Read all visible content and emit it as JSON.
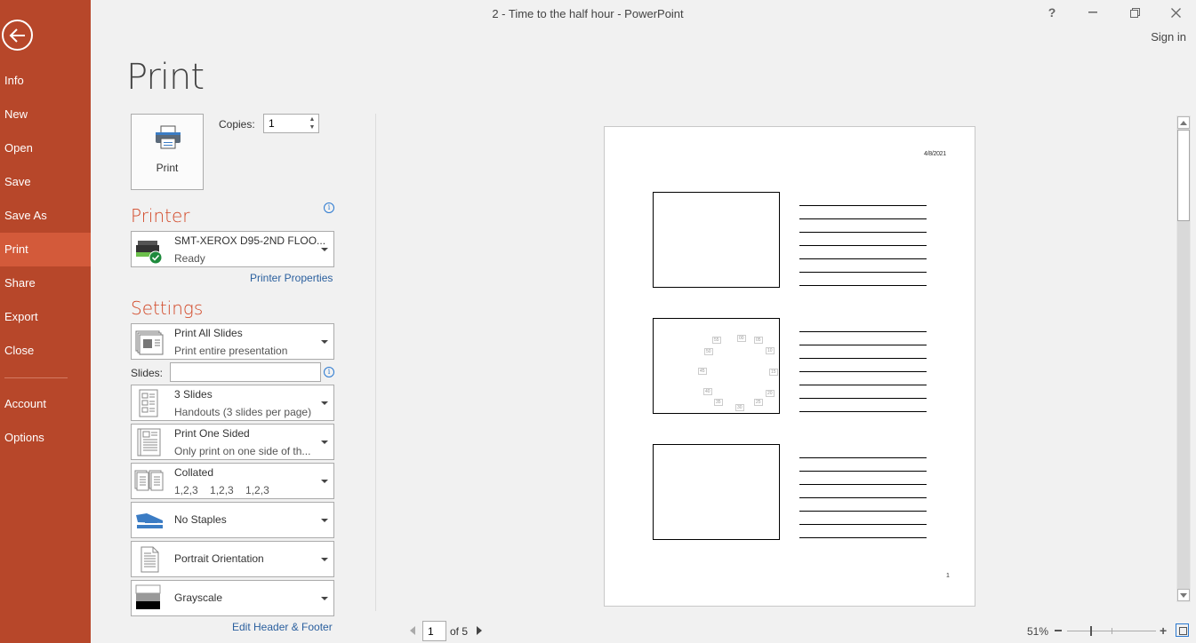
{
  "window": {
    "title": "2 - Time to the half hour - PowerPoint",
    "help_label": "?",
    "sign_in": "Sign in"
  },
  "sidebar": {
    "items": [
      {
        "label": "Info"
      },
      {
        "label": "New"
      },
      {
        "label": "Open"
      },
      {
        "label": "Save"
      },
      {
        "label": "Save As"
      },
      {
        "label": "Print",
        "active": true
      },
      {
        "label": "Share"
      },
      {
        "label": "Export"
      },
      {
        "label": "Close"
      },
      {
        "label": "Account"
      },
      {
        "label": "Options"
      }
    ],
    "accent_color": "#b7472a",
    "active_color": "#d35a3a"
  },
  "print": {
    "heading": "Print",
    "button_label": "Print",
    "copies_label": "Copies:",
    "copies_value": "1"
  },
  "printer": {
    "section_title": "Printer",
    "name": "SMT-XEROX D95-2ND FLOO...",
    "status": "Ready",
    "properties_link": "Printer Properties"
  },
  "settings": {
    "section_title": "Settings",
    "range": {
      "title": "Print All Slides",
      "subtitle": "Print entire presentation"
    },
    "slides_label": "Slides:",
    "slides_value": "",
    "layout": {
      "title": "3 Slides",
      "subtitle": "Handouts (3 slides per page)"
    },
    "sides": {
      "title": "Print One Sided",
      "subtitle": "Only print on one side of th..."
    },
    "collation": {
      "title": "Collated",
      "subtitle": "1,2,3    1,2,3    1,2,3"
    },
    "staples": {
      "title": "No Staples"
    },
    "orientation": {
      "title": "Portrait Orientation"
    },
    "color": {
      "title": "Grayscale"
    },
    "header_footer_link": "Edit Header & Footer"
  },
  "preview": {
    "date": "4/8/2021",
    "page_number": "1",
    "clock_labels": [
      "00",
      "05",
      "10",
      "15",
      "20",
      "25",
      "30",
      "35",
      "40",
      "45",
      "50",
      "55"
    ]
  },
  "pager": {
    "current": "1",
    "of_label": "of 5"
  },
  "zoom": {
    "level": "51%"
  }
}
